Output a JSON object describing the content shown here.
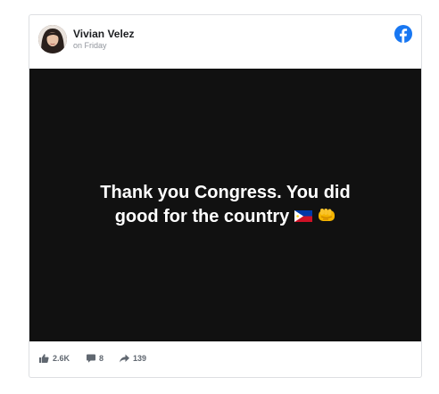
{
  "post": {
    "author": "Vivian Velez",
    "timestamp": "on Friday",
    "text_line1": "Thank you Congress. You did",
    "text_line2": "good for the country",
    "background_color": "#111111",
    "brand_color": "#1877f2",
    "emojis": [
      "philippines-flag-icon",
      "oncoming-fist-icon"
    ]
  },
  "stats": {
    "likes": "2.6K",
    "comments": "8",
    "shares": "139"
  }
}
